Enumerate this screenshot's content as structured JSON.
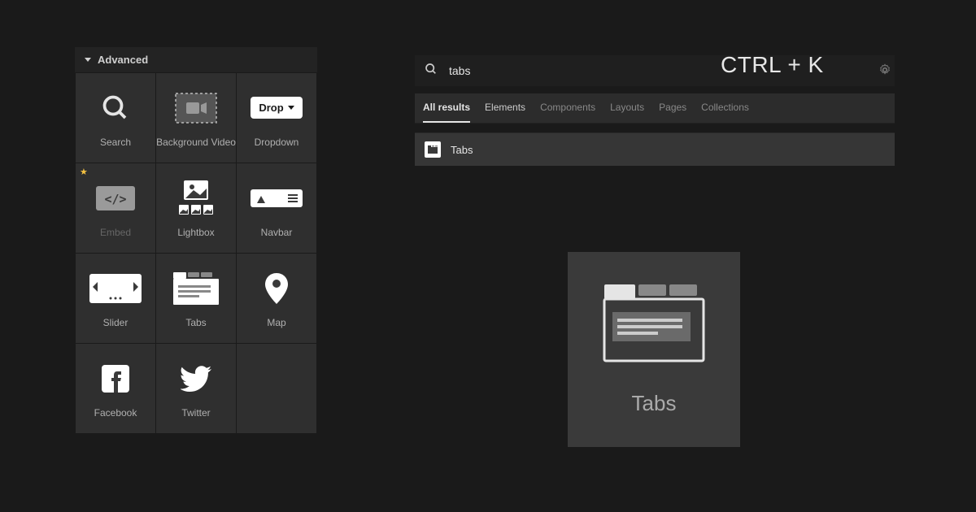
{
  "panel": {
    "title": "Advanced",
    "elements": [
      {
        "label": "Search",
        "icon": "search-icon"
      },
      {
        "label": "Background Video",
        "icon": "bgvideo-icon"
      },
      {
        "label": "Dropdown",
        "icon": "dropdown-icon"
      },
      {
        "label": "Embed",
        "icon": "embed-icon",
        "starred": true,
        "dimmed": true
      },
      {
        "label": "Lightbox",
        "icon": "lightbox-icon"
      },
      {
        "label": "Navbar",
        "icon": "navbar-icon"
      },
      {
        "label": "Slider",
        "icon": "slider-icon"
      },
      {
        "label": "Tabs",
        "icon": "tabs-icon"
      },
      {
        "label": "Map",
        "icon": "map-icon"
      },
      {
        "label": "Facebook",
        "icon": "facebook-icon"
      },
      {
        "label": "Twitter",
        "icon": "twitter-icon"
      }
    ]
  },
  "search": {
    "query": "tabs",
    "shortcut": "CTRL + K"
  },
  "filter_tabs": [
    {
      "label": "All results",
      "active": true
    },
    {
      "label": "Elements",
      "active": false
    },
    {
      "label": "Components",
      "active": false
    },
    {
      "label": "Layouts",
      "active": false
    },
    {
      "label": "Pages",
      "active": false
    },
    {
      "label": "Collections",
      "active": false
    }
  ],
  "results": [
    {
      "label": "Tabs",
      "icon": "tabs-small-icon"
    }
  ],
  "preview": {
    "label": "Tabs"
  },
  "dropdown_button_label": "Drop"
}
